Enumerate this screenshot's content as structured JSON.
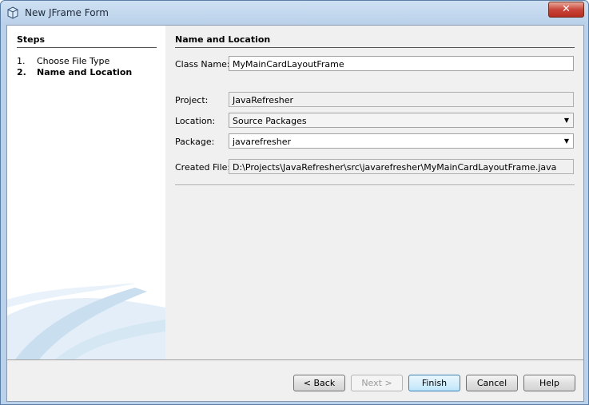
{
  "window": {
    "title": "New JFrame Form",
    "close_label": "✕"
  },
  "steps": {
    "title": "Steps",
    "items": [
      {
        "num": "1.",
        "label": "Choose File Type"
      },
      {
        "num": "2.",
        "label": "Name and Location"
      }
    ]
  },
  "form": {
    "section_title": "Name and Location",
    "class_name": {
      "label": "Class Name:",
      "value": "MyMainCardLayoutFrame"
    },
    "project": {
      "label": "Project:",
      "value": "JavaRefresher"
    },
    "location": {
      "label": "Location:",
      "value": "Source Packages"
    },
    "package": {
      "label": "Package:",
      "value": "javarefresher"
    },
    "created_file": {
      "label": "Created File:",
      "value": "D:\\Projects\\JavaRefresher\\src\\javarefresher\\MyMainCardLayoutFrame.java"
    }
  },
  "buttons": {
    "back": "< Back",
    "next": "Next >",
    "finish": "Finish",
    "cancel": "Cancel",
    "help": "Help"
  }
}
